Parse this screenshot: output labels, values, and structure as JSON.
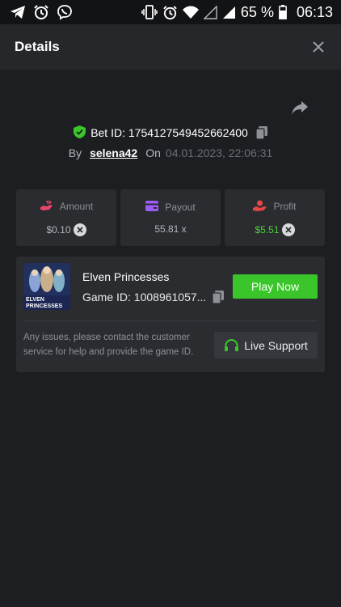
{
  "status_bar": {
    "battery": "65 %",
    "time": "06:13",
    "icons": [
      "telegram-icon",
      "alarm-icon",
      "viber-icon",
      "vibrate-icon",
      "alarm-icon",
      "wifi-icon",
      "signal-empty-icon",
      "signal-icon",
      "battery-icon"
    ]
  },
  "header": {
    "title": "Details"
  },
  "bet": {
    "id_text": "Bet ID: 1754127549452662400",
    "by_label": "By",
    "username": "selena42",
    "on_label": "On",
    "date": "04.01.2023, 22:06:31"
  },
  "stats": [
    {
      "label": "Amount",
      "value": "$0.10",
      "icon": "amount-icon",
      "color": "#e8456b"
    },
    {
      "label": "Payout",
      "value": "55.81 x",
      "icon": "wallet-icon",
      "color": "#9b5cf6"
    },
    {
      "label": "Profit",
      "value": "$5.51",
      "icon": "profit-icon",
      "color": "#e84545"
    }
  ],
  "game": {
    "name": "Elven Princesses",
    "id_text": "Game ID: 1008961057...",
    "thumb_text": "ELVEN PRINCESSES",
    "play_label": "Play Now"
  },
  "support": {
    "help_text": "Any issues, please contact the customer service for help and provide the game ID.",
    "button_label": "Live Support"
  },
  "colors": {
    "accent_green": "#3ac62a",
    "profit_green": "#4cd137",
    "shield_green": "#3ac62a"
  }
}
